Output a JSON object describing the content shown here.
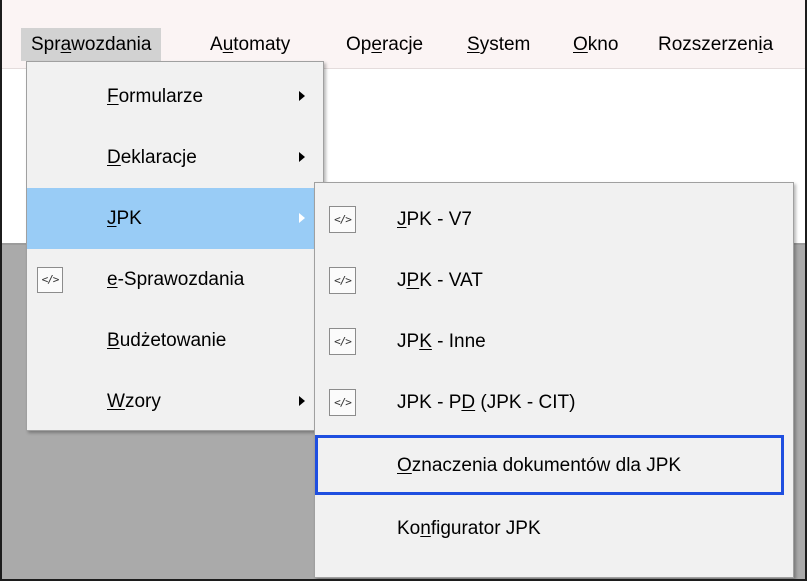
{
  "menubar": {
    "items": [
      {
        "pre": "Spr",
        "key": "a",
        "post": "wozdania",
        "active": true
      },
      {
        "pre": "A",
        "key": "u",
        "post": "tomaty",
        "active": false
      },
      {
        "pre": "Op",
        "key": "e",
        "post": "racje",
        "active": false
      },
      {
        "pre": "",
        "key": "S",
        "post": "ystem",
        "active": false
      },
      {
        "pre": "",
        "key": "O",
        "post": "kno",
        "active": false
      },
      {
        "pre": "Rozszerzen",
        "key": "i",
        "post": "a",
        "active": false
      }
    ]
  },
  "main_menu": {
    "items": [
      {
        "pre": "",
        "key": "F",
        "post": "ormularze",
        "submenu": true,
        "icon": "",
        "highlighted": false
      },
      {
        "pre": "",
        "key": "D",
        "post": "eklaracje",
        "submenu": true,
        "icon": "",
        "highlighted": false
      },
      {
        "pre": "",
        "key": "J",
        "post": "PK",
        "submenu": true,
        "icon": "",
        "highlighted": true
      },
      {
        "pre": "",
        "key": "e",
        "post": "-Sprawozdania",
        "submenu": false,
        "icon": "</>",
        "highlighted": false
      },
      {
        "pre": "",
        "key": "B",
        "post": "udżetowanie",
        "submenu": false,
        "icon": "",
        "highlighted": false
      },
      {
        "pre": "",
        "key": "W",
        "post": "zory",
        "submenu": true,
        "icon": "",
        "highlighted": false
      }
    ]
  },
  "jpk_submenu": {
    "items": [
      {
        "pre": "",
        "key": "J",
        "post": "PK - V7",
        "icon": "</>",
        "selected": false
      },
      {
        "pre": "J",
        "key": "P",
        "post": "K - VAT",
        "icon": "</>",
        "selected": false
      },
      {
        "pre": "JP",
        "key": "K",
        "post": " - Inne",
        "icon": "</>",
        "selected": false
      },
      {
        "pre": "JPK - P",
        "key": "D",
        "post": " (JPK - CIT)",
        "icon": "</>",
        "selected": false
      },
      {
        "pre": "",
        "key": "O",
        "post": "znaczenia dokumentów dla JPK",
        "icon": "",
        "selected": true
      },
      {
        "pre": "Ko",
        "key": "n",
        "post": "figurator JPK",
        "icon": "",
        "selected": false
      }
    ]
  },
  "colors": {
    "highlight": "#99ccf6",
    "selection_border": "#1f4fe0",
    "menu_bg": "#f1f1f1",
    "menubar_bg": "#fbf4f4",
    "workspace_gray": "#aaaaaa"
  }
}
